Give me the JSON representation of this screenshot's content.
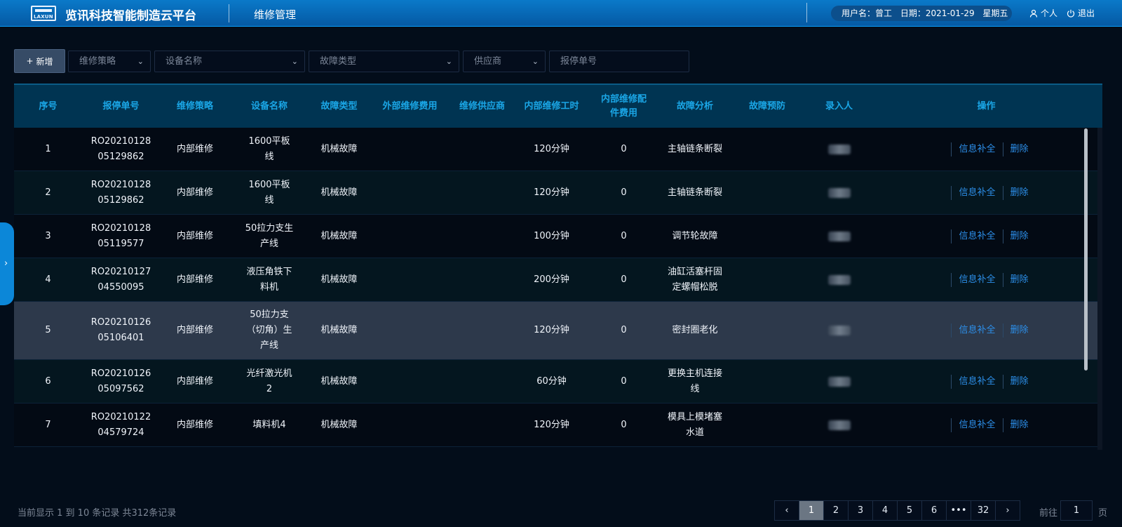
{
  "header": {
    "logo_text": "LAXUN",
    "app_title": "览讯科技智能制造云平台",
    "module_title": "维修管理",
    "user_label": "用户名：曾工",
    "date_label": "日期：2021-01-29",
    "weekday": "星期五",
    "profile_label": "个人",
    "logout_label": "退出"
  },
  "filters": {
    "add_label": "新增",
    "strategy_placeholder": "维修策略",
    "device_placeholder": "设备名称",
    "fault_type_placeholder": "故障类型",
    "supplier_placeholder": "供应商",
    "report_no_placeholder": "报停单号"
  },
  "table": {
    "columns": [
      "序号",
      "报停单号",
      "维修策略",
      "设备名称",
      "故障类型",
      "外部维修费用",
      "维修供应商",
      "内部维修工时",
      "内部维修配件费用",
      "故障分析",
      "故障预防",
      "录入人",
      "操作"
    ],
    "rows": [
      {
        "no": "1",
        "report_no": "RO20210128 05129862",
        "strategy": "内部维修",
        "device": "1600平板线",
        "fault_type": "机械故障",
        "ext_cost": "",
        "supplier": "",
        "hours": "120分钟",
        "parts_cost": "0",
        "analysis": "主轴链条断裂",
        "prevention": "",
        "op_edit": "信息补全",
        "op_delete": "删除"
      },
      {
        "no": "2",
        "report_no": "RO20210128 05129862",
        "strategy": "内部维修",
        "device": "1600平板线",
        "fault_type": "机械故障",
        "ext_cost": "",
        "supplier": "",
        "hours": "120分钟",
        "parts_cost": "0",
        "analysis": "主轴链条断裂",
        "prevention": "",
        "op_edit": "信息补全",
        "op_delete": "删除"
      },
      {
        "no": "3",
        "report_no": "RO20210128 05119577",
        "strategy": "内部维修",
        "device": "50拉力支生产线",
        "fault_type": "机械故障",
        "ext_cost": "",
        "supplier": "",
        "hours": "100分钟",
        "parts_cost": "0",
        "analysis": "调节轮故障",
        "prevention": "",
        "op_edit": "信息补全",
        "op_delete": "删除"
      },
      {
        "no": "4",
        "report_no": "RO20210127 04550095",
        "strategy": "内部维修",
        "device": "液压角铁下料机",
        "fault_type": "机械故障",
        "ext_cost": "",
        "supplier": "",
        "hours": "200分钟",
        "parts_cost": "0",
        "analysis": "油缸活塞杆固定螺帽松脱",
        "prevention": "",
        "op_edit": "信息补全",
        "op_delete": "删除"
      },
      {
        "no": "5",
        "report_no": "RO20210126 05106401",
        "strategy": "内部维修",
        "device": "50拉力支（切角）生产线",
        "fault_type": "机械故障",
        "ext_cost": "",
        "supplier": "",
        "hours": "120分钟",
        "parts_cost": "0",
        "analysis": "密封圈老化",
        "prevention": "",
        "op_edit": "信息补全",
        "op_delete": "删除"
      },
      {
        "no": "6",
        "report_no": "RO20210126 05097562",
        "strategy": "内部维修",
        "device": "光纤激光机2",
        "fault_type": "机械故障",
        "ext_cost": "",
        "supplier": "",
        "hours": "60分钟",
        "parts_cost": "0",
        "analysis": "更换主机连接线",
        "prevention": "",
        "op_edit": "信息补全",
        "op_delete": "删除"
      },
      {
        "no": "7",
        "report_no": "RO20210122 04579724",
        "strategy": "内部维修",
        "device": "填料机4",
        "fault_type": "机械故障",
        "ext_cost": "",
        "supplier": "",
        "hours": "120分钟",
        "parts_cost": "0",
        "analysis": "模具上模堵塞水道",
        "prevention": "",
        "op_edit": "信息补全",
        "op_delete": "删除"
      }
    ]
  },
  "footer": {
    "summary": "当前显示 1 到 10 条记录 共312条记录",
    "pages": [
      "1",
      "2",
      "3",
      "4",
      "5",
      "6",
      "•••",
      "32"
    ],
    "current_page": "1",
    "goto_prefix": "前往",
    "goto_value": "1",
    "goto_suffix": "页"
  },
  "colors": {
    "header_blue": "#0a79c9",
    "column_header_text": "#1aa6e6",
    "link_blue": "#2c8ee8",
    "background": "#030d1a"
  }
}
